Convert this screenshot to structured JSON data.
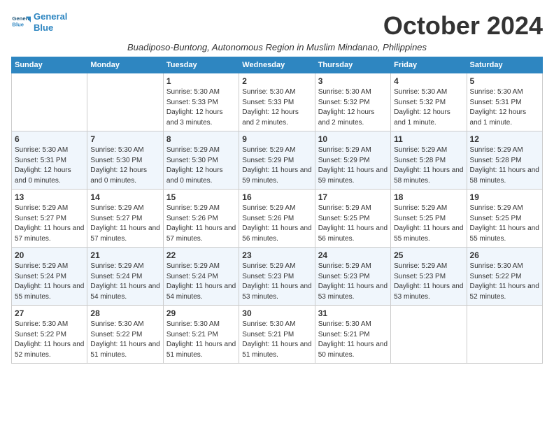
{
  "logo": {
    "line1": "General",
    "line2": "Blue"
  },
  "title": "October 2024",
  "subtitle": "Buadiposo-Buntong, Autonomous Region in Muslim Mindanao, Philippines",
  "days_of_week": [
    "Sunday",
    "Monday",
    "Tuesday",
    "Wednesday",
    "Thursday",
    "Friday",
    "Saturday"
  ],
  "weeks": [
    [
      {
        "day": "",
        "info": ""
      },
      {
        "day": "",
        "info": ""
      },
      {
        "day": "1",
        "info": "Sunrise: 5:30 AM\nSunset: 5:33 PM\nDaylight: 12 hours and 3 minutes."
      },
      {
        "day": "2",
        "info": "Sunrise: 5:30 AM\nSunset: 5:33 PM\nDaylight: 12 hours and 2 minutes."
      },
      {
        "day": "3",
        "info": "Sunrise: 5:30 AM\nSunset: 5:32 PM\nDaylight: 12 hours and 2 minutes."
      },
      {
        "day": "4",
        "info": "Sunrise: 5:30 AM\nSunset: 5:32 PM\nDaylight: 12 hours and 1 minute."
      },
      {
        "day": "5",
        "info": "Sunrise: 5:30 AM\nSunset: 5:31 PM\nDaylight: 12 hours and 1 minute."
      }
    ],
    [
      {
        "day": "6",
        "info": "Sunrise: 5:30 AM\nSunset: 5:31 PM\nDaylight: 12 hours and 0 minutes."
      },
      {
        "day": "7",
        "info": "Sunrise: 5:30 AM\nSunset: 5:30 PM\nDaylight: 12 hours and 0 minutes."
      },
      {
        "day": "8",
        "info": "Sunrise: 5:29 AM\nSunset: 5:30 PM\nDaylight: 12 hours and 0 minutes."
      },
      {
        "day": "9",
        "info": "Sunrise: 5:29 AM\nSunset: 5:29 PM\nDaylight: 11 hours and 59 minutes."
      },
      {
        "day": "10",
        "info": "Sunrise: 5:29 AM\nSunset: 5:29 PM\nDaylight: 11 hours and 59 minutes."
      },
      {
        "day": "11",
        "info": "Sunrise: 5:29 AM\nSunset: 5:28 PM\nDaylight: 11 hours and 58 minutes."
      },
      {
        "day": "12",
        "info": "Sunrise: 5:29 AM\nSunset: 5:28 PM\nDaylight: 11 hours and 58 minutes."
      }
    ],
    [
      {
        "day": "13",
        "info": "Sunrise: 5:29 AM\nSunset: 5:27 PM\nDaylight: 11 hours and 57 minutes."
      },
      {
        "day": "14",
        "info": "Sunrise: 5:29 AM\nSunset: 5:27 PM\nDaylight: 11 hours and 57 minutes."
      },
      {
        "day": "15",
        "info": "Sunrise: 5:29 AM\nSunset: 5:26 PM\nDaylight: 11 hours and 57 minutes."
      },
      {
        "day": "16",
        "info": "Sunrise: 5:29 AM\nSunset: 5:26 PM\nDaylight: 11 hours and 56 minutes."
      },
      {
        "day": "17",
        "info": "Sunrise: 5:29 AM\nSunset: 5:25 PM\nDaylight: 11 hours and 56 minutes."
      },
      {
        "day": "18",
        "info": "Sunrise: 5:29 AM\nSunset: 5:25 PM\nDaylight: 11 hours and 55 minutes."
      },
      {
        "day": "19",
        "info": "Sunrise: 5:29 AM\nSunset: 5:25 PM\nDaylight: 11 hours and 55 minutes."
      }
    ],
    [
      {
        "day": "20",
        "info": "Sunrise: 5:29 AM\nSunset: 5:24 PM\nDaylight: 11 hours and 55 minutes."
      },
      {
        "day": "21",
        "info": "Sunrise: 5:29 AM\nSunset: 5:24 PM\nDaylight: 11 hours and 54 minutes."
      },
      {
        "day": "22",
        "info": "Sunrise: 5:29 AM\nSunset: 5:24 PM\nDaylight: 11 hours and 54 minutes."
      },
      {
        "day": "23",
        "info": "Sunrise: 5:29 AM\nSunset: 5:23 PM\nDaylight: 11 hours and 53 minutes."
      },
      {
        "day": "24",
        "info": "Sunrise: 5:29 AM\nSunset: 5:23 PM\nDaylight: 11 hours and 53 minutes."
      },
      {
        "day": "25",
        "info": "Sunrise: 5:29 AM\nSunset: 5:23 PM\nDaylight: 11 hours and 53 minutes."
      },
      {
        "day": "26",
        "info": "Sunrise: 5:30 AM\nSunset: 5:22 PM\nDaylight: 11 hours and 52 minutes."
      }
    ],
    [
      {
        "day": "27",
        "info": "Sunrise: 5:30 AM\nSunset: 5:22 PM\nDaylight: 11 hours and 52 minutes."
      },
      {
        "day": "28",
        "info": "Sunrise: 5:30 AM\nSunset: 5:22 PM\nDaylight: 11 hours and 51 minutes."
      },
      {
        "day": "29",
        "info": "Sunrise: 5:30 AM\nSunset: 5:21 PM\nDaylight: 11 hours and 51 minutes."
      },
      {
        "day": "30",
        "info": "Sunrise: 5:30 AM\nSunset: 5:21 PM\nDaylight: 11 hours and 51 minutes."
      },
      {
        "day": "31",
        "info": "Sunrise: 5:30 AM\nSunset: 5:21 PM\nDaylight: 11 hours and 50 minutes."
      },
      {
        "day": "",
        "info": ""
      },
      {
        "day": "",
        "info": ""
      }
    ]
  ]
}
